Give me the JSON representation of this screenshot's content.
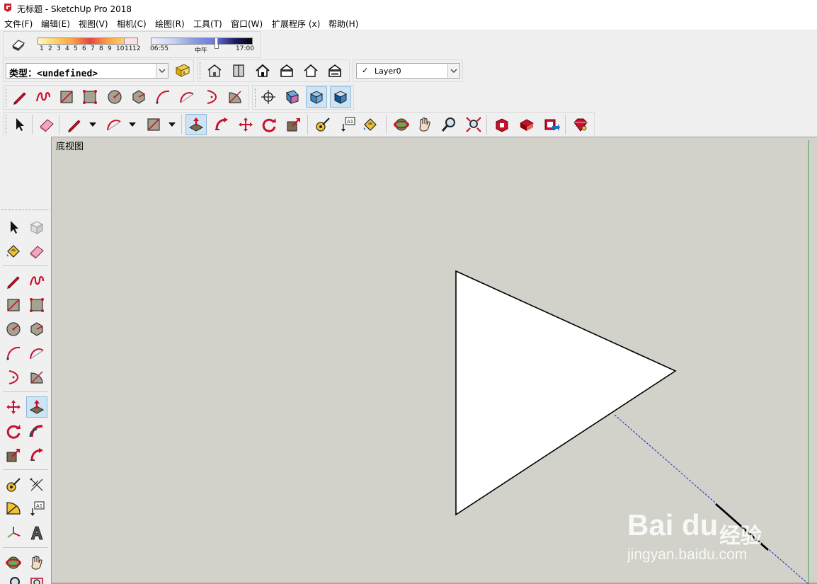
{
  "window": {
    "title": "无标题 - SketchUp Pro 2018"
  },
  "menu": [
    "文件(F)",
    "编辑(E)",
    "视图(V)",
    "相机(C)",
    "绘图(R)",
    "工具(T)",
    "窗口(W)",
    "扩展程序 (x)",
    "帮助(H)"
  ],
  "shadow": {
    "months": [
      "1",
      "2",
      "3",
      "4",
      "5",
      "6",
      "7",
      "8",
      "9",
      "10",
      "11",
      "12"
    ],
    "time_start": "06:55",
    "time_mid": "中午",
    "time_end": "17:00"
  },
  "type_select": {
    "value": "类型：<undefined>"
  },
  "layer_select": {
    "check": "✓",
    "value": "Layer0"
  },
  "viewport": {
    "view_label": "底视图",
    "background": "#d2d2ca"
  },
  "watermark": {
    "brand": "Bai du",
    "jingyan": "经验",
    "url": "jingyan.baidu.com"
  },
  "colors": {
    "accent_red": "#c8102e",
    "tool_blue": "#cde4f5",
    "axis_blue": "#2222cc",
    "axis_green": "#3aa055"
  }
}
